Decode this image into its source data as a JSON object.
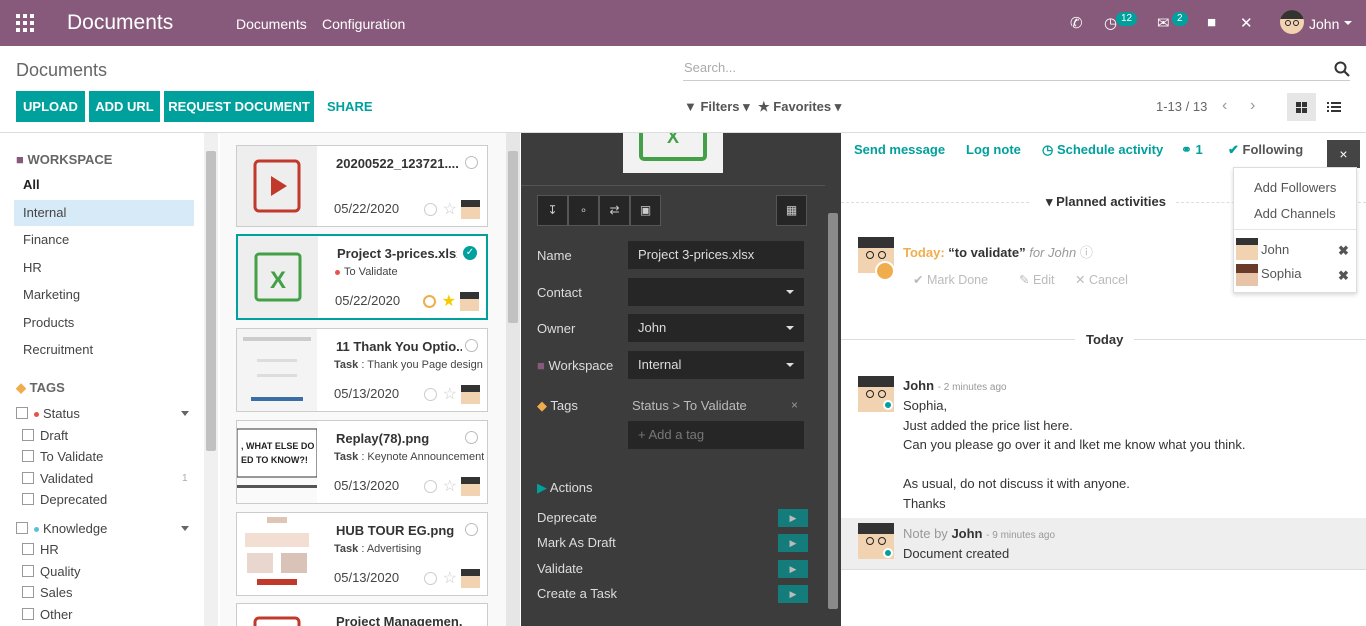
{
  "app": {
    "title": "Documents",
    "menu": [
      "Documents",
      "Configuration"
    ],
    "badges": {
      "activities": "12",
      "messages": "2"
    },
    "user": "John"
  },
  "controlpanel": {
    "breadcrumb": "Documents",
    "search_placeholder": "Search...",
    "buttons": {
      "upload": "UPLOAD",
      "add_url": "ADD URL",
      "request": "REQUEST DOCUMENT",
      "share": "SHARE"
    },
    "filters": "Filters",
    "favorites": "Favorites",
    "pager": "1-13 / 13"
  },
  "sidebar": {
    "workspace_header": "WORKSPACE",
    "workspaces": [
      "All",
      "Internal",
      "Finance",
      "HR",
      "Marketing",
      "Products",
      "Recruitment"
    ],
    "tags_header": "TAGS",
    "status": {
      "label": "Status",
      "items": [
        {
          "label": "Draft",
          "count": ""
        },
        {
          "label": "To Validate",
          "count": ""
        },
        {
          "label": "Validated",
          "count": "1"
        },
        {
          "label": "Deprecated",
          "count": ""
        }
      ]
    },
    "knowledge": {
      "label": "Knowledge",
      "items": [
        "HR",
        "Quality",
        "Sales",
        "Other"
      ]
    }
  },
  "cards": [
    {
      "name": "20200522_123721....",
      "sub": "",
      "date": "05/22/2020"
    },
    {
      "name": "Project 3-prices.xlsx",
      "sub": "To Validate",
      "date": "05/22/2020"
    },
    {
      "name": "11 Thank You Optio...",
      "sub_strong": "Task",
      "sub": " : Thank you Page design",
      "date": "05/13/2020"
    },
    {
      "name": "Replay(78).png",
      "sub_strong": "Task",
      "sub": " : Keynote Announcement",
      "date": "05/13/2020"
    },
    {
      "name": "HUB TOUR EG.png",
      "sub_strong": "Task",
      "sub": " : Advertising",
      "date": "05/13/2020"
    },
    {
      "name": "Project Managemen...",
      "sub": "",
      "date": ""
    }
  ],
  "inspector": {
    "labels": {
      "name": "Name",
      "contact": "Contact",
      "owner": "Owner",
      "workspace": "Workspace",
      "tags": "Tags",
      "actions": "Actions"
    },
    "values": {
      "name": "Project 3-prices.xlsx",
      "contact": "",
      "owner": "John",
      "workspace": "Internal",
      "tag_path": "Status > To Validate",
      "tag_placeholder": "+ Add a tag"
    },
    "actions": [
      "Deprecate",
      "Mark As Draft",
      "Validate",
      "Create a Task"
    ]
  },
  "chatter": {
    "tabs": {
      "send": "Send message",
      "log": "Log note",
      "schedule": "Schedule activity",
      "attach": "1",
      "following": "Following"
    },
    "planned": "Planned activities",
    "activity": {
      "when": "Today:",
      "title": "“to validate”",
      "for": "for John",
      "done": "Mark Done",
      "edit": "Edit",
      "cancel": "Cancel"
    },
    "today": "Today",
    "msg1": {
      "author": "John",
      "time": "- 2 minutes ago",
      "lines": [
        "Sophia,",
        "Just added the price list here.",
        "Can you please go over it and lket me know what you think.",
        "",
        "As usual, do not discuss it with anyone.",
        "Thanks"
      ]
    },
    "msg2": {
      "prefix": "Note by",
      "author": "John",
      "time": "- 9 minutes ago",
      "body": "Document created"
    },
    "followers": {
      "add_followers": "Add Followers",
      "add_channels": "Add Channels",
      "list": [
        "John",
        "Sophia"
      ]
    }
  }
}
